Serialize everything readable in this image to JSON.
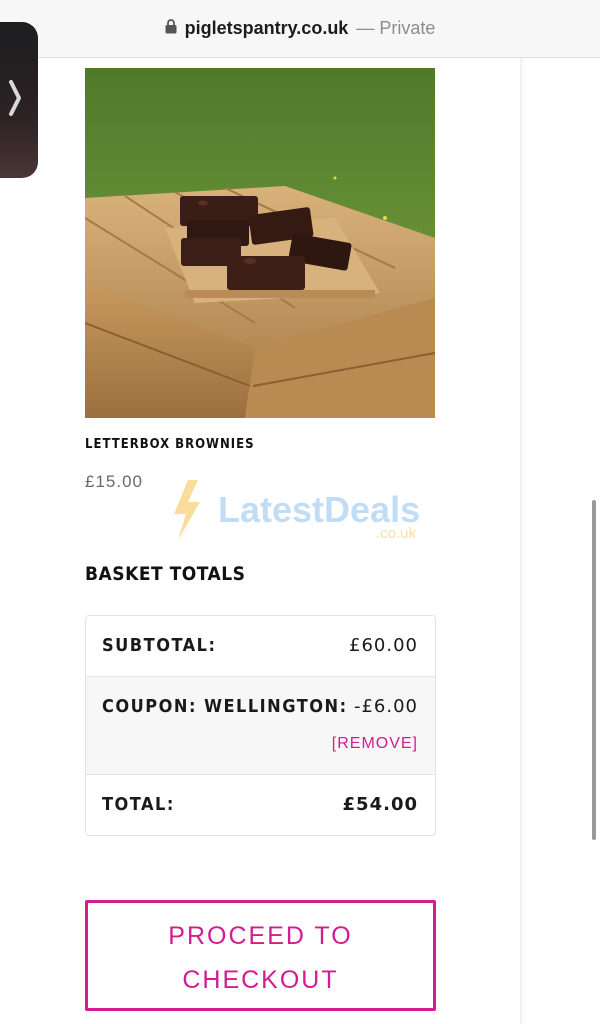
{
  "browser": {
    "domain": "pigletspantry.co.uk",
    "mode": "— Private"
  },
  "product": {
    "name": "LETTERBOX BROWNIES",
    "price": "£15.00"
  },
  "watermark": {
    "brand": "LatestDeals",
    "suffix": ".co.uk"
  },
  "basket": {
    "heading": "BASKET TOTALS",
    "subtotal_label": "SUBTOTAL:",
    "subtotal_value": "£60.00",
    "coupon_label": "COUPON: WELLINGTON:",
    "coupon_value": "-£6.00",
    "remove_label": "[REMOVE]",
    "total_label": "TOTAL:",
    "total_value": "£54.00"
  },
  "checkout": {
    "line1": "PROCEED TO",
    "line2": "CHECKOUT"
  },
  "colors": {
    "accent": "#d21c8f"
  },
  "icons": {
    "lock": "lock-icon",
    "side_tab": "chevron-right-icon"
  }
}
